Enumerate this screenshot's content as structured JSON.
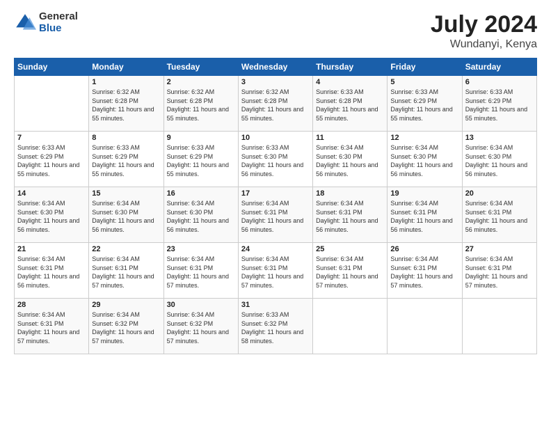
{
  "logo": {
    "general": "General",
    "blue": "Blue"
  },
  "title": "July 2024",
  "subtitle": "Wundanyi, Kenya",
  "days_header": [
    "Sunday",
    "Monday",
    "Tuesday",
    "Wednesday",
    "Thursday",
    "Friday",
    "Saturday"
  ],
  "weeks": [
    [
      {
        "day": "",
        "sunrise": "",
        "sunset": "",
        "daylight": ""
      },
      {
        "day": "1",
        "sunrise": "Sunrise: 6:32 AM",
        "sunset": "Sunset: 6:28 PM",
        "daylight": "Daylight: 11 hours and 55 minutes."
      },
      {
        "day": "2",
        "sunrise": "Sunrise: 6:32 AM",
        "sunset": "Sunset: 6:28 PM",
        "daylight": "Daylight: 11 hours and 55 minutes."
      },
      {
        "day": "3",
        "sunrise": "Sunrise: 6:32 AM",
        "sunset": "Sunset: 6:28 PM",
        "daylight": "Daylight: 11 hours and 55 minutes."
      },
      {
        "day": "4",
        "sunrise": "Sunrise: 6:33 AM",
        "sunset": "Sunset: 6:28 PM",
        "daylight": "Daylight: 11 hours and 55 minutes."
      },
      {
        "day": "5",
        "sunrise": "Sunrise: 6:33 AM",
        "sunset": "Sunset: 6:29 PM",
        "daylight": "Daylight: 11 hours and 55 minutes."
      },
      {
        "day": "6",
        "sunrise": "Sunrise: 6:33 AM",
        "sunset": "Sunset: 6:29 PM",
        "daylight": "Daylight: 11 hours and 55 minutes."
      }
    ],
    [
      {
        "day": "7",
        "sunrise": "Sunrise: 6:33 AM",
        "sunset": "Sunset: 6:29 PM",
        "daylight": "Daylight: 11 hours and 55 minutes."
      },
      {
        "day": "8",
        "sunrise": "Sunrise: 6:33 AM",
        "sunset": "Sunset: 6:29 PM",
        "daylight": "Daylight: 11 hours and 55 minutes."
      },
      {
        "day": "9",
        "sunrise": "Sunrise: 6:33 AM",
        "sunset": "Sunset: 6:29 PM",
        "daylight": "Daylight: 11 hours and 55 minutes."
      },
      {
        "day": "10",
        "sunrise": "Sunrise: 6:33 AM",
        "sunset": "Sunset: 6:30 PM",
        "daylight": "Daylight: 11 hours and 56 minutes."
      },
      {
        "day": "11",
        "sunrise": "Sunrise: 6:34 AM",
        "sunset": "Sunset: 6:30 PM",
        "daylight": "Daylight: 11 hours and 56 minutes."
      },
      {
        "day": "12",
        "sunrise": "Sunrise: 6:34 AM",
        "sunset": "Sunset: 6:30 PM",
        "daylight": "Daylight: 11 hours and 56 minutes."
      },
      {
        "day": "13",
        "sunrise": "Sunrise: 6:34 AM",
        "sunset": "Sunset: 6:30 PM",
        "daylight": "Daylight: 11 hours and 56 minutes."
      }
    ],
    [
      {
        "day": "14",
        "sunrise": "Sunrise: 6:34 AM",
        "sunset": "Sunset: 6:30 PM",
        "daylight": "Daylight: 11 hours and 56 minutes."
      },
      {
        "day": "15",
        "sunrise": "Sunrise: 6:34 AM",
        "sunset": "Sunset: 6:30 PM",
        "daylight": "Daylight: 11 hours and 56 minutes."
      },
      {
        "day": "16",
        "sunrise": "Sunrise: 6:34 AM",
        "sunset": "Sunset: 6:30 PM",
        "daylight": "Daylight: 11 hours and 56 minutes."
      },
      {
        "day": "17",
        "sunrise": "Sunrise: 6:34 AM",
        "sunset": "Sunset: 6:31 PM",
        "daylight": "Daylight: 11 hours and 56 minutes."
      },
      {
        "day": "18",
        "sunrise": "Sunrise: 6:34 AM",
        "sunset": "Sunset: 6:31 PM",
        "daylight": "Daylight: 11 hours and 56 minutes."
      },
      {
        "day": "19",
        "sunrise": "Sunrise: 6:34 AM",
        "sunset": "Sunset: 6:31 PM",
        "daylight": "Daylight: 11 hours and 56 minutes."
      },
      {
        "day": "20",
        "sunrise": "Sunrise: 6:34 AM",
        "sunset": "Sunset: 6:31 PM",
        "daylight": "Daylight: 11 hours and 56 minutes."
      }
    ],
    [
      {
        "day": "21",
        "sunrise": "Sunrise: 6:34 AM",
        "sunset": "Sunset: 6:31 PM",
        "daylight": "Daylight: 11 hours and 56 minutes."
      },
      {
        "day": "22",
        "sunrise": "Sunrise: 6:34 AM",
        "sunset": "Sunset: 6:31 PM",
        "daylight": "Daylight: 11 hours and 57 minutes."
      },
      {
        "day": "23",
        "sunrise": "Sunrise: 6:34 AM",
        "sunset": "Sunset: 6:31 PM",
        "daylight": "Daylight: 11 hours and 57 minutes."
      },
      {
        "day": "24",
        "sunrise": "Sunrise: 6:34 AM",
        "sunset": "Sunset: 6:31 PM",
        "daylight": "Daylight: 11 hours and 57 minutes."
      },
      {
        "day": "25",
        "sunrise": "Sunrise: 6:34 AM",
        "sunset": "Sunset: 6:31 PM",
        "daylight": "Daylight: 11 hours and 57 minutes."
      },
      {
        "day": "26",
        "sunrise": "Sunrise: 6:34 AM",
        "sunset": "Sunset: 6:31 PM",
        "daylight": "Daylight: 11 hours and 57 minutes."
      },
      {
        "day": "27",
        "sunrise": "Sunrise: 6:34 AM",
        "sunset": "Sunset: 6:31 PM",
        "daylight": "Daylight: 11 hours and 57 minutes."
      }
    ],
    [
      {
        "day": "28",
        "sunrise": "Sunrise: 6:34 AM",
        "sunset": "Sunset: 6:31 PM",
        "daylight": "Daylight: 11 hours and 57 minutes."
      },
      {
        "day": "29",
        "sunrise": "Sunrise: 6:34 AM",
        "sunset": "Sunset: 6:32 PM",
        "daylight": "Daylight: 11 hours and 57 minutes."
      },
      {
        "day": "30",
        "sunrise": "Sunrise: 6:34 AM",
        "sunset": "Sunset: 6:32 PM",
        "daylight": "Daylight: 11 hours and 57 minutes."
      },
      {
        "day": "31",
        "sunrise": "Sunrise: 6:33 AM",
        "sunset": "Sunset: 6:32 PM",
        "daylight": "Daylight: 11 hours and 58 minutes."
      },
      {
        "day": "",
        "sunrise": "",
        "sunset": "",
        "daylight": ""
      },
      {
        "day": "",
        "sunrise": "",
        "sunset": "",
        "daylight": ""
      },
      {
        "day": "",
        "sunrise": "",
        "sunset": "",
        "daylight": ""
      }
    ]
  ]
}
